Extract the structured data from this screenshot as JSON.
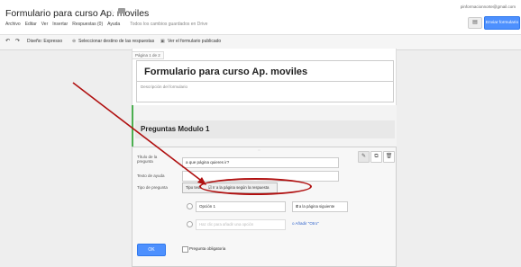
{
  "app": {
    "title": "Formulario para curso Ap. moviles",
    "account_email": "pinformacionnorte@gmail.com",
    "send_button": "Enviar formulario",
    "comment_icon": "comment-icon"
  },
  "menu": {
    "items": [
      "Archivo",
      "Editar",
      "Ver",
      "Insertar",
      "Respuestas (0)",
      "Ayuda"
    ],
    "save_status": "Todos los cambios guardados en Drive"
  },
  "toolbar": {
    "undo_icon": "undo-icon",
    "redo_icon": "redo-icon",
    "theme_label": "Diseño: Expresso",
    "destination_label": "Seleccionar destino de las respuestas",
    "view_label": "Ver el formulario publicado"
  },
  "form": {
    "page_label": "Página 1 de 2",
    "title": "Formulario para curso Ap. moviles",
    "description_placeholder": "Descripción del formulario",
    "section_title": "Preguntas Modulo 1"
  },
  "editor": {
    "handle": ":::",
    "question_title_label": "Título de la pregunta",
    "question_title_value": "a que página quieres ir?",
    "help_text_label": "Texto de ayuda",
    "question_type_label": "Tipo de pregunta",
    "question_type_value": "Tipo test",
    "page_nav_checkbox": "Ir a la página según la respuesta",
    "option1_value": "Opción 1",
    "option1_goto": "Ir a la página siguiente",
    "option2_placeholder": "Haz clic para añadir una opción",
    "add_other": "o Añadir \"Otro\"",
    "ok_button": "OK",
    "required_label": "Pregunta obligatoria",
    "edit_icon": "pencil-icon",
    "duplicate_icon": "duplicate-icon",
    "delete_icon": "trash-icon"
  },
  "colors": {
    "accent_blue": "#4d90fe",
    "annotation_red": "#b01010",
    "section_green": "#4caf50"
  }
}
